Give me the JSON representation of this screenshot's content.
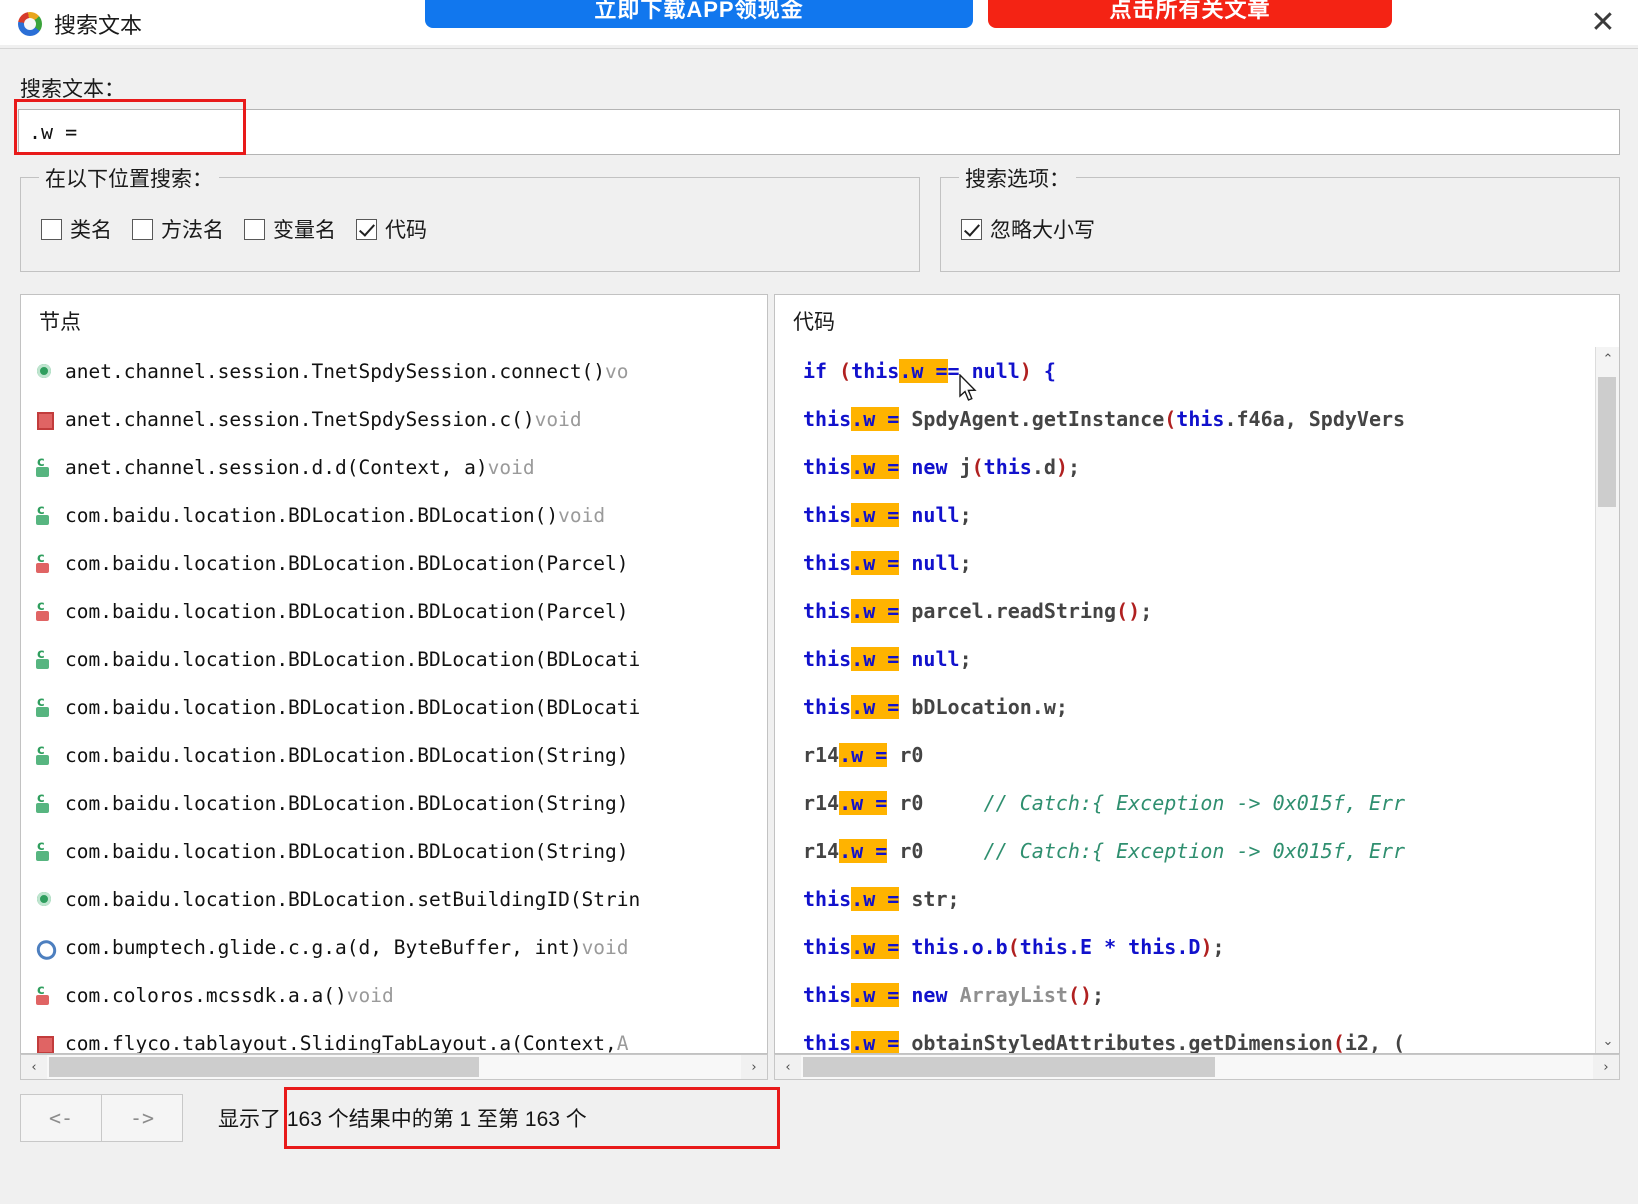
{
  "window": {
    "title": "搜索文本",
    "icon": "app-logo-icon",
    "close_label": "✕"
  },
  "banner": {
    "primary_button": "立即下载APP领现金",
    "secondary_button": "点击所有关文章"
  },
  "search": {
    "label": "搜索文本：",
    "value": ".w =",
    "placeholder": ""
  },
  "location_group": {
    "legend": "在以下位置搜索：",
    "options": [
      {
        "label": "类名",
        "checked": false
      },
      {
        "label": "方法名",
        "checked": false
      },
      {
        "label": "变量名",
        "checked": false
      },
      {
        "label": "代码",
        "checked": true
      }
    ]
  },
  "options_group": {
    "legend": "搜索选项：",
    "options": [
      {
        "label": "忽略大小写",
        "checked": true
      }
    ]
  },
  "nodes_panel": {
    "header": "节点",
    "rows": [
      {
        "icon": "pub-method",
        "text": "anet.channel.session.TnetSpdySession.connect()",
        "ret": " vo"
      },
      {
        "icon": "priv-method",
        "text": "anet.channel.session.TnetSpdySession.c()",
        "ret": " void"
      },
      {
        "icon": "pub-ctor",
        "text": "anet.channel.session.d.d(Context, a)",
        "ret": " void"
      },
      {
        "icon": "pub-ctor",
        "text": "com.baidu.location.BDLocation.BDLocation()",
        "ret": " void"
      },
      {
        "icon": "priv-ctor",
        "text": "com.baidu.location.BDLocation.BDLocation(Parcel)",
        "ret": ""
      },
      {
        "icon": "priv-ctor",
        "text": "com.baidu.location.BDLocation.BDLocation(Parcel)",
        "ret": ""
      },
      {
        "icon": "pub-ctor",
        "text": "com.baidu.location.BDLocation.BDLocation(BDLocati",
        "ret": ""
      },
      {
        "icon": "pub-ctor",
        "text": "com.baidu.location.BDLocation.BDLocation(BDLocati",
        "ret": ""
      },
      {
        "icon": "pub-ctor",
        "text": "com.baidu.location.BDLocation.BDLocation(String)",
        "ret": ""
      },
      {
        "icon": "pub-ctor",
        "text": "com.baidu.location.BDLocation.BDLocation(String)",
        "ret": ""
      },
      {
        "icon": "pub-ctor",
        "text": "com.baidu.location.BDLocation.BDLocation(String)",
        "ret": ""
      },
      {
        "icon": "pub-method",
        "text": "com.baidu.location.BDLocation.setBuildingID(Strin",
        "ret": ""
      },
      {
        "icon": "link",
        "text": "com.bumptech.glide.c.g.a(d, ByteBuffer, int)",
        "ret": " void"
      },
      {
        "icon": "priv-ctor",
        "text": "com.coloros.mcssdk.a.a()",
        "ret": " void"
      },
      {
        "icon": "priv-method",
        "text": "com.flyco.tablayout.SlidingTabLayout.a(Context,",
        "ret": " A"
      }
    ]
  },
  "code_panel": {
    "header": "代码",
    "highlight_token": ".w =",
    "lines": [
      [
        {
          "t": "if ",
          "c": "kw"
        },
        {
          "t": "(",
          "c": "paren"
        },
        {
          "t": "this",
          "c": "kw"
        },
        {
          "t": ".w =",
          "c": "hl"
        },
        {
          "t": "= ",
          "c": "kw"
        },
        {
          "t": "null",
          "c": "kw"
        },
        {
          "t": ")",
          "c": "paren"
        },
        {
          "t": " {",
          "c": "kw"
        }
      ],
      [
        {
          "t": "this",
          "c": "kw"
        },
        {
          "t": ".w =",
          "c": "hl"
        },
        {
          "t": " SpdyAgent.getInstance",
          "c": "ident"
        },
        {
          "t": "(",
          "c": "paren"
        },
        {
          "t": "this",
          "c": "kw"
        },
        {
          "t": ".f46a",
          "c": "ident"
        },
        {
          "t": ", SpdyVers",
          "c": "ident"
        }
      ],
      [
        {
          "t": "this",
          "c": "kw"
        },
        {
          "t": ".w =",
          "c": "hl"
        },
        {
          "t": " new ",
          "c": "kw"
        },
        {
          "t": "j",
          "c": "ident"
        },
        {
          "t": "(",
          "c": "paren"
        },
        {
          "t": "this",
          "c": "kw"
        },
        {
          "t": ".d",
          "c": "ident"
        },
        {
          "t": ")",
          "c": "paren"
        },
        {
          "t": ";",
          "c": "ident"
        }
      ],
      [
        {
          "t": "this",
          "c": "kw"
        },
        {
          "t": ".w =",
          "c": "hl"
        },
        {
          "t": " null",
          "c": "kw"
        },
        {
          "t": ";",
          "c": "ident"
        }
      ],
      [
        {
          "t": "this",
          "c": "kw"
        },
        {
          "t": ".w =",
          "c": "hl"
        },
        {
          "t": " null",
          "c": "kw"
        },
        {
          "t": ";",
          "c": "ident"
        }
      ],
      [
        {
          "t": "this",
          "c": "kw"
        },
        {
          "t": ".w =",
          "c": "hl"
        },
        {
          "t": " parcel.readString",
          "c": "ident"
        },
        {
          "t": "()",
          "c": "paren"
        },
        {
          "t": ";",
          "c": "ident"
        }
      ],
      [
        {
          "t": "this",
          "c": "kw"
        },
        {
          "t": ".w =",
          "c": "hl"
        },
        {
          "t": " null",
          "c": "kw"
        },
        {
          "t": ";",
          "c": "ident"
        }
      ],
      [
        {
          "t": "this",
          "c": "kw"
        },
        {
          "t": ".w =",
          "c": "hl"
        },
        {
          "t": " bDLocation.w;",
          "c": "ident"
        }
      ],
      [
        {
          "t": "r14",
          "c": "ident"
        },
        {
          "t": ".w =",
          "c": "hl"
        },
        {
          "t": " r0",
          "c": "ident"
        }
      ],
      [
        {
          "t": "r14",
          "c": "ident"
        },
        {
          "t": ".w =",
          "c": "hl"
        },
        {
          "t": " r0",
          "c": "ident"
        },
        {
          "t": "     // Catch:{ Exception -> 0x015f, Err",
          "c": "cmt"
        }
      ],
      [
        {
          "t": "r14",
          "c": "ident"
        },
        {
          "t": ".w =",
          "c": "hl"
        },
        {
          "t": " r0",
          "c": "ident"
        },
        {
          "t": "     // Catch:{ Exception -> 0x015f, Err",
          "c": "cmt"
        }
      ],
      [
        {
          "t": "this",
          "c": "kw"
        },
        {
          "t": ".w =",
          "c": "hl"
        },
        {
          "t": " str;",
          "c": "ident"
        }
      ],
      [
        {
          "t": "this",
          "c": "kw"
        },
        {
          "t": ".w =",
          "c": "hl"
        },
        {
          "t": " this",
          "c": "kw"
        },
        {
          "t": ".o.b",
          "c": "kw"
        },
        {
          "t": "(",
          "c": "paren"
        },
        {
          "t": "this",
          "c": "kw"
        },
        {
          "t": ".E * ",
          "c": "kw"
        },
        {
          "t": "this",
          "c": "kw"
        },
        {
          "t": ".D",
          "c": "kw"
        },
        {
          "t": ")",
          "c": "paren"
        },
        {
          "t": ";",
          "c": "ident"
        }
      ],
      [
        {
          "t": "this",
          "c": "kw"
        },
        {
          "t": ".w =",
          "c": "hl"
        },
        {
          "t": " new ",
          "c": "kw"
        },
        {
          "t": "ArrayList",
          "c": "gray"
        },
        {
          "t": "()",
          "c": "paren"
        },
        {
          "t": ";",
          "c": "ident"
        }
      ],
      [
        {
          "t": "this",
          "c": "kw"
        },
        {
          "t": ".w =",
          "c": "hl"
        },
        {
          "t": " obtainStyledAttributes.getDimension",
          "c": "ident"
        },
        {
          "t": "(",
          "c": "paren"
        },
        {
          "t": "i2, (",
          "c": "ident"
        }
      ]
    ]
  },
  "scroll": {
    "up_arrow": "⌃",
    "down_arrow": "⌄",
    "left_arrow": "‹",
    "right_arrow": "›"
  },
  "statusbar": {
    "prev_label": "<-",
    "next_label": "->",
    "result_text": "显示了 163 个结果中的第 1 至第 163 个",
    "total_results": "163",
    "range_from": "1",
    "range_to": "163"
  },
  "colors": {
    "highlight": "#ffb300",
    "keyword": "#1111cc",
    "comment": "#2f8f6f",
    "redbox": "#e81a1a",
    "banner_blue": "#1177ee",
    "banner_red": "#f42314"
  }
}
